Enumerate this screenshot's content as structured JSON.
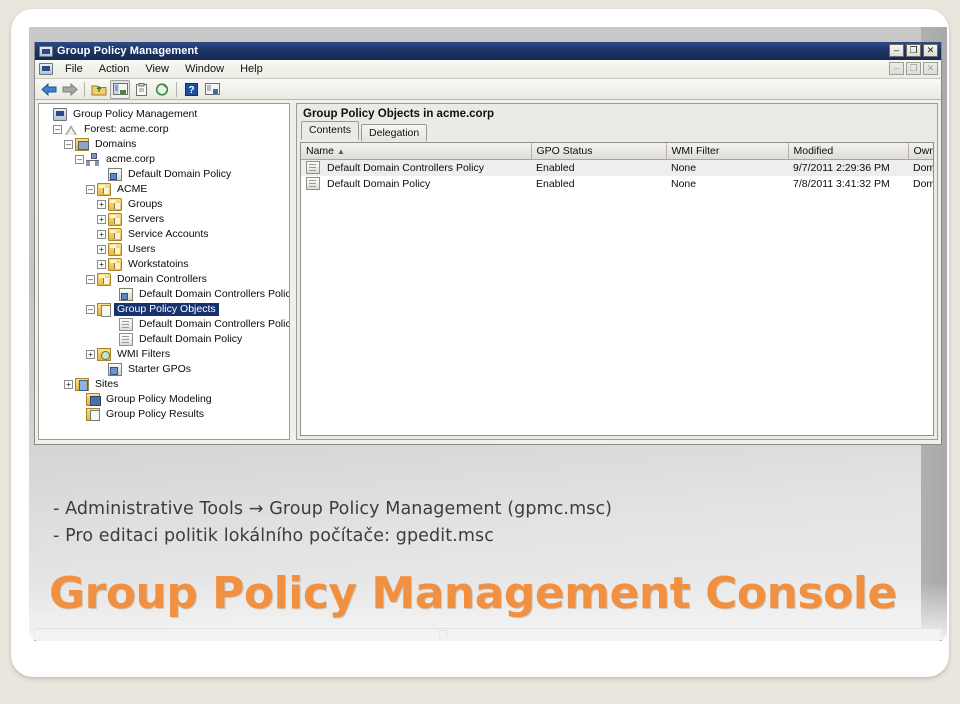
{
  "slide": {
    "bullets": [
      "- Administrative Tools → Group Policy Management (gpmc.msc)",
      "- Pro editaci politik lokálního počítače: gpedit.msc"
    ],
    "title": "Group Policy Management Console",
    "accent_color": "#f09040",
    "background_color": "#e9e6dd"
  },
  "window": {
    "title": "Group Policy Management",
    "title_icon": "console-icon",
    "titlebar_color": "#1d3568",
    "controls": [
      {
        "name": "minimize",
        "glyph": "–"
      },
      {
        "name": "restore",
        "glyph": "❐"
      },
      {
        "name": "close",
        "glyph": "✕"
      }
    ],
    "mdi_controls": [
      {
        "name": "minimize",
        "glyph": "–"
      },
      {
        "name": "restore",
        "glyph": "❐"
      },
      {
        "name": "close",
        "glyph": "✕"
      }
    ],
    "menus": [
      "File",
      "Action",
      "View",
      "Window",
      "Help"
    ],
    "toolbar": [
      {
        "name": "back-icon",
        "label": "Back"
      },
      {
        "name": "forward-icon",
        "label": "Forward"
      },
      {
        "sep": true
      },
      {
        "name": "up-one-level-icon",
        "label": "Up One Level"
      },
      {
        "name": "show-hide-tree-icon",
        "label": "Show/Hide Console Tree",
        "pressed": true
      },
      {
        "name": "properties-icon",
        "label": "Properties"
      },
      {
        "name": "refresh-icon",
        "label": "Refresh"
      },
      {
        "sep": true
      },
      {
        "name": "help-icon",
        "label": "Help"
      },
      {
        "name": "export-list-icon",
        "label": "Export List"
      }
    ]
  },
  "tree": {
    "nodes": [
      {
        "label": "Group Policy Management",
        "indent": 0,
        "expander": "none",
        "icon": "console-icon",
        "selected": false
      },
      {
        "label": "Forest: acme.corp",
        "indent": 1,
        "expander": "minus",
        "icon": "forest-icon",
        "selected": false
      },
      {
        "label": "Domains",
        "indent": 2,
        "expander": "minus",
        "icon": "domains-folder-icon",
        "selected": false
      },
      {
        "label": "acme.corp",
        "indent": 3,
        "expander": "minus",
        "icon": "domain-icon",
        "selected": false
      },
      {
        "label": "Default Domain Policy",
        "indent": 5,
        "expander": "none",
        "icon": "gpo-link-icon",
        "selected": false
      },
      {
        "label": "ACME",
        "indent": 4,
        "expander": "minus",
        "icon": "ou-folder-icon",
        "selected": false
      },
      {
        "label": "Groups",
        "indent": 5,
        "expander": "plus",
        "icon": "ou-folder-icon",
        "selected": false
      },
      {
        "label": "Servers",
        "indent": 5,
        "expander": "plus",
        "icon": "ou-folder-icon",
        "selected": false
      },
      {
        "label": "Service Accounts",
        "indent": 5,
        "expander": "plus",
        "icon": "ou-folder-icon",
        "selected": false
      },
      {
        "label": "Users",
        "indent": 5,
        "expander": "plus",
        "icon": "ou-folder-icon",
        "selected": false
      },
      {
        "label": "Workstatoins",
        "indent": 5,
        "expander": "plus",
        "icon": "ou-folder-icon",
        "selected": false
      },
      {
        "label": "Domain Controllers",
        "indent": 4,
        "expander": "minus",
        "icon": "ou-folder-icon",
        "selected": false
      },
      {
        "label": "Default Domain Controllers Polic",
        "indent": 6,
        "expander": "none",
        "icon": "gpo-link-icon",
        "selected": false
      },
      {
        "label": "Group Policy Objects",
        "indent": 4,
        "expander": "minus",
        "icon": "gpo-container-icon",
        "selected": true
      },
      {
        "label": "Default Domain Controllers Polic",
        "indent": 6,
        "expander": "none",
        "icon": "gpo-icon",
        "selected": false
      },
      {
        "label": "Default Domain Policy",
        "indent": 6,
        "expander": "none",
        "icon": "gpo-icon",
        "selected": false
      },
      {
        "label": "WMI Filters",
        "indent": 4,
        "expander": "plus",
        "icon": "wmi-filter-icon",
        "selected": false
      },
      {
        "label": "Starter GPOs",
        "indent": 5,
        "expander": "none",
        "icon": "starter-gpo-icon",
        "selected": false
      },
      {
        "label": "Sites",
        "indent": 2,
        "expander": "plus",
        "icon": "sites-icon",
        "selected": false
      },
      {
        "label": "Group Policy Modeling",
        "indent": 3,
        "expander": "none",
        "icon": "modeling-icon",
        "selected": false
      },
      {
        "label": "Group Policy Results",
        "indent": 3,
        "expander": "none",
        "icon": "results-icon",
        "selected": false
      }
    ]
  },
  "details": {
    "header": "Group Policy Objects in acme.corp",
    "tabs": [
      {
        "label": "Contents",
        "active": true
      },
      {
        "label": "Delegation",
        "active": false
      }
    ],
    "columns": [
      {
        "label": "Name",
        "sorted": "asc"
      },
      {
        "label": "GPO Status"
      },
      {
        "label": "WMI Filter"
      },
      {
        "label": "Modified"
      },
      {
        "label": "Owner"
      }
    ],
    "rows": [
      {
        "icon": "gpo-icon",
        "name": "Default Domain Controllers Policy",
        "gpo_status": "Enabled",
        "wmi_filter": "None",
        "modified": "9/7/2011 2:29:36 PM",
        "owner": "Domain Ad",
        "highlighted": true
      },
      {
        "icon": "gpo-icon",
        "name": "Default Domain Policy",
        "gpo_status": "Enabled",
        "wmi_filter": "None",
        "modified": "7/8/2011 3:41:32 PM",
        "owner": "Domain Ad",
        "highlighted": false
      }
    ]
  }
}
